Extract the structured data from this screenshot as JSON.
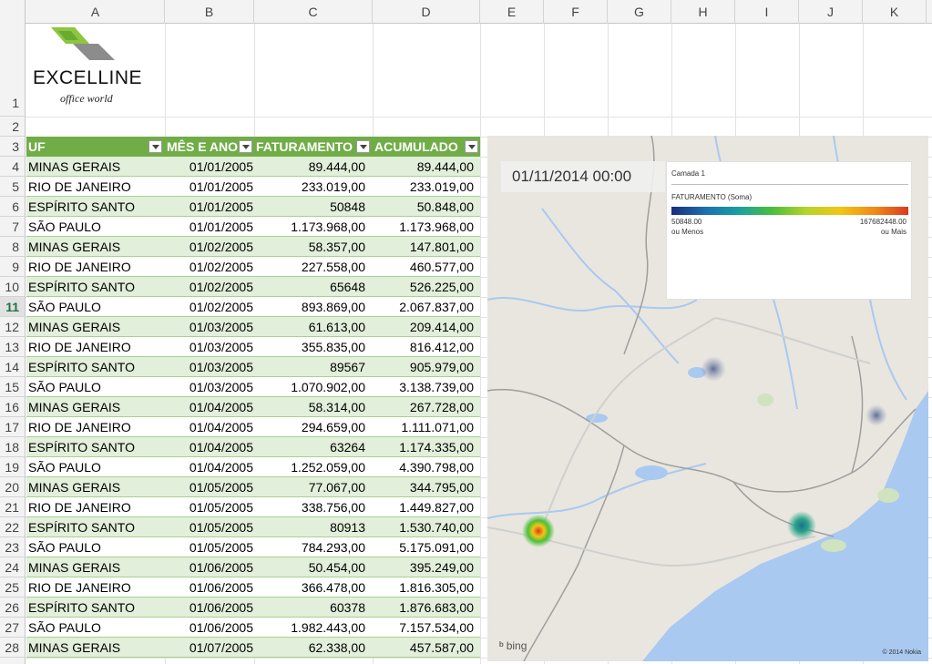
{
  "sheet": {
    "columns": [
      "A",
      "B",
      "C",
      "D",
      "E",
      "F",
      "G",
      "H",
      "I",
      "J",
      "K"
    ],
    "rows": [
      "1",
      "2",
      "3",
      "4",
      "5",
      "6",
      "7",
      "8",
      "9",
      "10",
      "11",
      "12",
      "13",
      "14",
      "15",
      "16",
      "17",
      "18",
      "19",
      "20",
      "21",
      "22",
      "23",
      "24",
      "25",
      "26",
      "27",
      "28"
    ],
    "active_row": "11"
  },
  "logo": {
    "brand": "EXCELLINE",
    "tagline": "office world",
    "colors": {
      "green": "#8dc63f",
      "gray": "#8c8c8c"
    }
  },
  "table": {
    "header_color": "#70ad47",
    "band_color": "#e2efda",
    "headers": [
      "UF",
      "MÊS E ANO",
      "FATURAMENTO",
      "ACUMULADO"
    ],
    "rows": [
      {
        "uf": "MINAS GERAIS",
        "mes": "01/01/2005",
        "fat": "89.444,00",
        "acu": "89.444,00"
      },
      {
        "uf": "RIO DE JANEIRO",
        "mes": "01/01/2005",
        "fat": "233.019,00",
        "acu": "233.019,00"
      },
      {
        "uf": "ESPÍRITO SANTO",
        "mes": "01/01/2005",
        "fat": "50848",
        "acu": "50.848,00"
      },
      {
        "uf": "SÃO PAULO",
        "mes": "01/01/2005",
        "fat": "1.173.968,00",
        "acu": "1.173.968,00"
      },
      {
        "uf": "MINAS GERAIS",
        "mes": "01/02/2005",
        "fat": "58.357,00",
        "acu": "147.801,00"
      },
      {
        "uf": "RIO DE JANEIRO",
        "mes": "01/02/2005",
        "fat": "227.558,00",
        "acu": "460.577,00"
      },
      {
        "uf": "ESPÍRITO SANTO",
        "mes": "01/02/2005",
        "fat": "65648",
        "acu": "526.225,00"
      },
      {
        "uf": "SÃO PAULO",
        "mes": "01/02/2005",
        "fat": "893.869,00",
        "acu": "2.067.837,00"
      },
      {
        "uf": "MINAS GERAIS",
        "mes": "01/03/2005",
        "fat": "61.613,00",
        "acu": "209.414,00"
      },
      {
        "uf": "RIO DE JANEIRO",
        "mes": "01/03/2005",
        "fat": "355.835,00",
        "acu": "816.412,00"
      },
      {
        "uf": "ESPÍRITO SANTO",
        "mes": "01/03/2005",
        "fat": "89567",
        "acu": "905.979,00"
      },
      {
        "uf": "SÃO PAULO",
        "mes": "01/03/2005",
        "fat": "1.070.902,00",
        "acu": "3.138.739,00"
      },
      {
        "uf": "MINAS GERAIS",
        "mes": "01/04/2005",
        "fat": "58.314,00",
        "acu": "267.728,00"
      },
      {
        "uf": "RIO DE JANEIRO",
        "mes": "01/04/2005",
        "fat": "294.659,00",
        "acu": "1.111.071,00"
      },
      {
        "uf": "ESPÍRITO SANTO",
        "mes": "01/04/2005",
        "fat": "63264",
        "acu": "1.174.335,00"
      },
      {
        "uf": "SÃO PAULO",
        "mes": "01/04/2005",
        "fat": "1.252.059,00",
        "acu": "4.390.798,00"
      },
      {
        "uf": "MINAS GERAIS",
        "mes": "01/05/2005",
        "fat": "77.067,00",
        "acu": "344.795,00"
      },
      {
        "uf": "RIO DE JANEIRO",
        "mes": "01/05/2005",
        "fat": "338.756,00",
        "acu": "1.449.827,00"
      },
      {
        "uf": "ESPÍRITO SANTO",
        "mes": "01/05/2005",
        "fat": "80913",
        "acu": "1.530.740,00"
      },
      {
        "uf": "SÃO PAULO",
        "mes": "01/05/2005",
        "fat": "784.293,00",
        "acu": "5.175.091,00"
      },
      {
        "uf": "MINAS GERAIS",
        "mes": "01/06/2005",
        "fat": "50.454,00",
        "acu": "395.249,00"
      },
      {
        "uf": "RIO DE JANEIRO",
        "mes": "01/06/2005",
        "fat": "366.478,00",
        "acu": "1.816.305,00"
      },
      {
        "uf": "ESPÍRITO SANTO",
        "mes": "01/06/2005",
        "fat": "60378",
        "acu": "1.876.683,00"
      },
      {
        "uf": "SÃO PAULO",
        "mes": "01/06/2005",
        "fat": "1.982.443,00",
        "acu": "7.157.534,00"
      },
      {
        "uf": "MINAS GERAIS",
        "mes": "01/07/2005",
        "fat": "62.338,00",
        "acu": "457.587,00"
      }
    ]
  },
  "map": {
    "timestamp": "01/11/2014 00:00",
    "layer_name": "Camada 1",
    "field": "FATURAMENTO (Soma)",
    "min_value": "50848.00",
    "max_value": "167682448.00",
    "min_label": "ou Menos",
    "max_label": "ou Mais",
    "provider": "bing",
    "copyright": "© 2014 Nokia",
    "colors": {
      "land": "#e9e6df",
      "water": "#a9c9f0",
      "border": "#9e9e9e",
      "road": "#cfd0cf"
    }
  }
}
